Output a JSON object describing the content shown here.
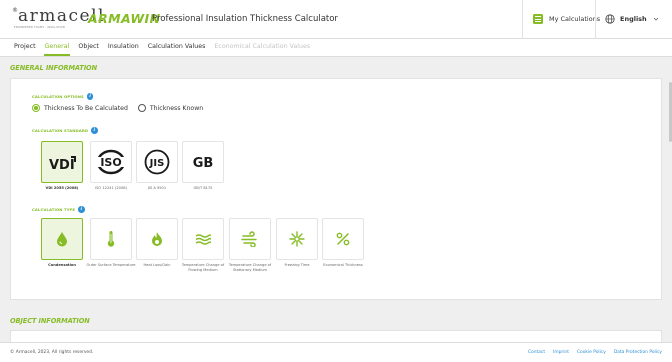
{
  "header": {
    "logo": {
      "registered": "®",
      "word": "armacell",
      "tagline": "ENGINEERED FOAMS · INSULATION"
    },
    "brand": "ARMAWIN",
    "app_title": "Professional Insulation Thickness Calculator",
    "my_calculations": {
      "label": "My Calculations",
      "icon": "calculator-icon"
    },
    "language": {
      "label": "English",
      "icon": "globe-icon",
      "chevron": "chevron-down-icon"
    }
  },
  "tabs": [
    {
      "label": "Project",
      "state": "normal"
    },
    {
      "label": "General",
      "state": "active"
    },
    {
      "label": "Object",
      "state": "normal"
    },
    {
      "label": "Insulation",
      "state": "normal"
    },
    {
      "label": "Calculation Values",
      "state": "normal"
    },
    {
      "label": "Economical Calculation Values",
      "state": "disabled"
    }
  ],
  "general": {
    "title": "GENERAL INFORMATION",
    "options": {
      "label": "CALCULATION OPTIONS",
      "choices": [
        {
          "label": "Thickness To Be Calculated",
          "selected": true
        },
        {
          "label": "Thickness Known",
          "selected": false
        }
      ]
    },
    "standard": {
      "label": "CALCULATION STANDARD",
      "items": [
        {
          "logo": "VDI",
          "caption": "VDI 2055 (2008)",
          "selected": true
        },
        {
          "logo": "ISO",
          "caption": "ISO 12241 (2008)",
          "selected": false
        },
        {
          "logo": "JIS",
          "caption": "JIS A 9501",
          "selected": false
        },
        {
          "logo": "GB",
          "caption": "GB/T 8175",
          "selected": false
        }
      ]
    },
    "type": {
      "label": "CALCULATION TYPE",
      "items": [
        {
          "icon": "water-drop-icon",
          "caption": "Condensation",
          "selected": true
        },
        {
          "icon": "thermometer-icon",
          "caption": "Outer Surface Temperature",
          "selected": false
        },
        {
          "icon": "flame-icon",
          "caption": "Heat Loss/Gain",
          "selected": false
        },
        {
          "icon": "flowing-medium-icon",
          "caption": "Temperature Change of Flowing Medium",
          "selected": false
        },
        {
          "icon": "stationary-medium-icon",
          "caption": "Temperature Change of Stationary Medium",
          "selected": false
        },
        {
          "icon": "snowflake-icon",
          "caption": "Freezing Time",
          "selected": false
        },
        {
          "icon": "percent-icon",
          "caption": "Economical Thickness",
          "selected": false
        }
      ]
    }
  },
  "object": {
    "title": "OBJECT INFORMATION"
  },
  "footer": {
    "copyright": "© Armacell, 2023, All rights reserved.",
    "links": [
      "Contact",
      "Imprint",
      "Cookie Policy",
      "Data Protection Policy"
    ]
  },
  "colors": {
    "accent": "#86bc25",
    "info": "#2d8fd5",
    "selected_bg": "#eef5df"
  }
}
